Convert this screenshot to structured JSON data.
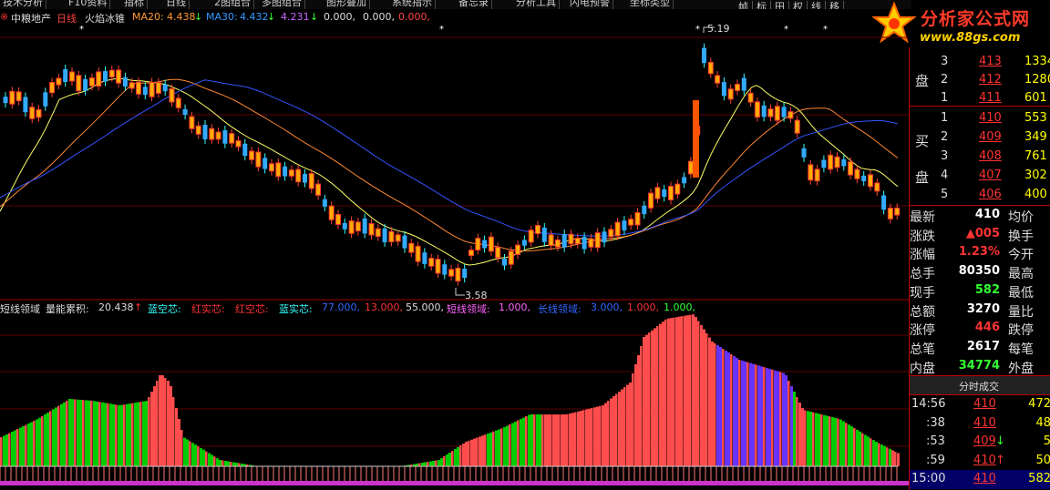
{
  "menu": [
    "技术分析",
    "F10资料",
    "指标",
    "日线",
    "2图组合",
    "多图组合",
    "图形叠加",
    "系统指示",
    "备忘录",
    "分析工具",
    "闪电预警",
    "坐标类型"
  ],
  "right_tabs": [
    "帧",
    "标",
    "田",
    "权",
    "线",
    "移"
  ],
  "logo": {
    "name": "分析家公式网",
    "url": "www.88gs.com"
  },
  "main_info": {
    "marker": "※",
    "stock": "中粮地产",
    "period": "日线",
    "indicator": "火焰冰锥",
    "ma20_label": "MA20:",
    "ma20": "4.438",
    "ma30_label": "MA30:",
    "ma30": "4.432",
    "extra1": "4.231",
    "z1": "0.000,",
    "z2": "0.000,",
    "z3": "0.000,"
  },
  "annotations": {
    "high": "5.19",
    "low": "3.58"
  },
  "lower_info": {
    "name": "短线领域",
    "vol_label": "量能累积:",
    "vol_value": "20.438",
    "l1": "蓝空芯:",
    "l2": "红实芯:",
    "l3": "红空芯:",
    "l4": "蓝实芯:",
    "v1": "77.000,",
    "v2": "13.000,",
    "v3": "55.000,",
    "l5": "短线领域:",
    "v5": "1.000,",
    "l6": "长线领域:",
    "v6": "3.000,",
    "v7": "1.000,",
    "v8": "1.000,"
  },
  "orderbook": {
    "sell_label": "盘",
    "buy_label_top": "买",
    "buy_label_bottom": "盘",
    "sells": [
      {
        "lvl": "3",
        "price": "413",
        "vol": "1334"
      },
      {
        "lvl": "2",
        "price": "412",
        "vol": "1280"
      },
      {
        "lvl": "1",
        "price": "411",
        "vol": "601"
      }
    ],
    "buys": [
      {
        "lvl": "1",
        "price": "410",
        "vol": "553"
      },
      {
        "lvl": "2",
        "price": "409",
        "vol": "349"
      },
      {
        "lvl": "3",
        "price": "408",
        "vol": "761"
      },
      {
        "lvl": "4",
        "price": "407",
        "vol": "302"
      },
      {
        "lvl": "5",
        "price": "406",
        "vol": "400"
      }
    ]
  },
  "quote": [
    {
      "label": "最新",
      "value": "410",
      "label2": "均价",
      "color": "#fff"
    },
    {
      "label": "涨跌",
      "value": "▲005",
      "label2": "换手",
      "color": "#ff3333"
    },
    {
      "label": "涨幅",
      "value": "1.23%",
      "label2": "今开",
      "color": "#ff3333"
    },
    {
      "label": "总手",
      "value": "80350",
      "label2": "最高",
      "color": "#fff"
    },
    {
      "label": "现手",
      "value": "582",
      "label2": "最低",
      "color": "#33ff33"
    },
    {
      "label": "总额",
      "value": "3270",
      "label2": "量比",
      "color": "#fff"
    },
    {
      "label": "涨停",
      "value": "446",
      "label2": "跌停",
      "color": "#ff3333"
    },
    {
      "label": "总笔",
      "value": "2617",
      "label2": "每笔",
      "color": "#fff"
    },
    {
      "label": "内盘",
      "value": "34774",
      "label2": "外盘",
      "color": "#33ff33"
    }
  ],
  "ticks_title": "分时成交",
  "ticks": [
    {
      "time": "14:56",
      "price": "410",
      "arrow": "",
      "vol": "472",
      "vc": "#ffff00"
    },
    {
      "time": ":38",
      "price": "410",
      "arrow": "",
      "vol": "48",
      "vc": "#ffff00"
    },
    {
      "time": ":53",
      "price": "409",
      "arrow": "↓",
      "vol": "5",
      "vc": "#ffff00"
    },
    {
      "time": ":59",
      "price": "410",
      "arrow": "↑",
      "vol": "50",
      "vc": "#ffff00"
    },
    {
      "time": "15:00",
      "price": "410",
      "arrow": "",
      "vol": "582",
      "vc": "#ffff00"
    }
  ],
  "colors": {
    "up": "#ff3333",
    "down": "#33ffff",
    "ma_yellow": "#ffff66",
    "ma_orange": "#ff9933",
    "ma_blue": "#3366ff",
    "green": "#00cc00",
    "red": "#ff4c4c",
    "purple": "#6633ff",
    "grid": "#8b0000"
  }
}
